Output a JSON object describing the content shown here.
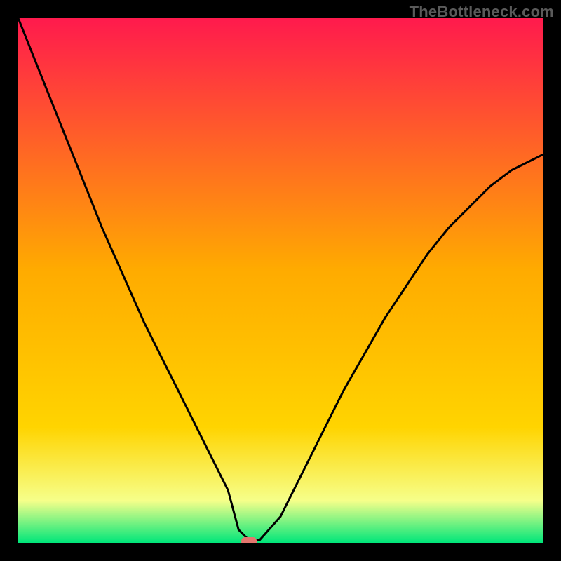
{
  "watermark": "TheBottleneck.com",
  "chart_data": {
    "type": "line",
    "title": "",
    "xlabel": "",
    "ylabel": "",
    "xlim": [
      0,
      100
    ],
    "ylim": [
      0,
      100
    ],
    "grid": false,
    "legend": false,
    "background_gradient": {
      "top_color": "#ff1a4d",
      "mid_color": "#ffd400",
      "low_color": "#f6ff8a",
      "bottom_color": "#00e67a"
    },
    "marker": {
      "shape": "rounded-rect",
      "color": "#e4766e",
      "x": 44,
      "y": 0
    },
    "series": [
      {
        "name": "bottleneck-curve",
        "color": "#000000",
        "x": [
          0,
          4,
          8,
          12,
          16,
          20,
          24,
          28,
          32,
          36,
          40,
          42,
          44,
          46,
          50,
          54,
          58,
          62,
          66,
          70,
          74,
          78,
          82,
          86,
          90,
          94,
          98,
          100
        ],
        "y": [
          100,
          90,
          80,
          70,
          60,
          51,
          42,
          34,
          26,
          18,
          10,
          2.5,
          0.5,
          0.5,
          5,
          13,
          21,
          29,
          36,
          43,
          49,
          55,
          60,
          64,
          68,
          71,
          73,
          74
        ]
      }
    ]
  }
}
